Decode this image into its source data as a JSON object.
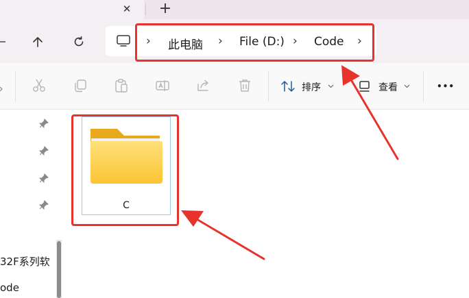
{
  "window": {
    "new_tab_glyph": "+",
    "close_tab_glyph": "✕"
  },
  "nav": {
    "back_icon": "up-arrow-icon",
    "refresh_icon": "refresh-icon",
    "breadcrumbs": [
      "此电脑",
      "File (D:)",
      "Code"
    ],
    "chevron": "›"
  },
  "toolbar": {
    "sort_label": "排序",
    "view_label": "查看",
    "more_glyph": "•••"
  },
  "sidebar": {
    "partial_items": [
      "32F系列软",
      "ode"
    ]
  },
  "content": {
    "items": [
      {
        "name": "C",
        "type": "folder",
        "selected": true
      }
    ]
  },
  "annotations": {
    "highlight_color": "#e8322c"
  }
}
